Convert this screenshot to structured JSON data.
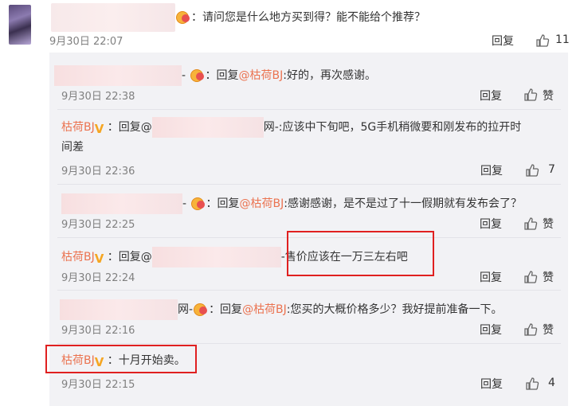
{
  "top": {
    "question": "：请问您是什么地方买到得？能不能给个推荐？",
    "time": "9月30日 22:07",
    "reply_label": "回复",
    "like_count": "11"
  },
  "replies": [
    {
      "prefix": "- ",
      "body_a": "：回复",
      "mention": "@枯荷BJ",
      "body_b": ":好的，再次感谢。",
      "time": "9月30日 22:38",
      "reply_label": "回复",
      "like_label": "赞"
    },
    {
      "name": "枯荷BJ",
      "body_a": "：回复@",
      "tail": "网-:应该中下旬吧，5G手机稍微要和刚发布的拉开时",
      "line2": "间差",
      "time": "9月30日 22:36",
      "reply_label": "回复",
      "like_count": "7"
    },
    {
      "prefix": "- ",
      "body_a": "：回复",
      "mention": "@枯荷BJ",
      "body_b": ":感谢感谢，是不是过了十一假期就有发布会了？",
      "time": "9月30日 22:25",
      "reply_label": "回复",
      "like_label": "赞"
    },
    {
      "name": "枯荷BJ",
      "body_a": "：回复@",
      "tail": "-",
      "highlight": "售价应该在一万三左右吧",
      "time": "9月30日 22:24",
      "reply_label": "回复",
      "like_label": "赞"
    },
    {
      "prefix": "网-",
      "body_a": "：回复",
      "mention": "@枯荷BJ",
      "body_b": ":您买的大概价格多少？我好提前准备一下。",
      "time": "9月30日 22:16",
      "reply_label": "回复",
      "like_label": "赞"
    },
    {
      "name": "枯荷BJ",
      "body_a": "：十月开始卖。",
      "time": "9月30日 22:15",
      "reply_label": "回复",
      "like_count": "4"
    }
  ],
  "colors": {
    "accent": "#eb7350",
    "highlight_border": "#e02020",
    "sub_bg": "#f2f2f5"
  }
}
